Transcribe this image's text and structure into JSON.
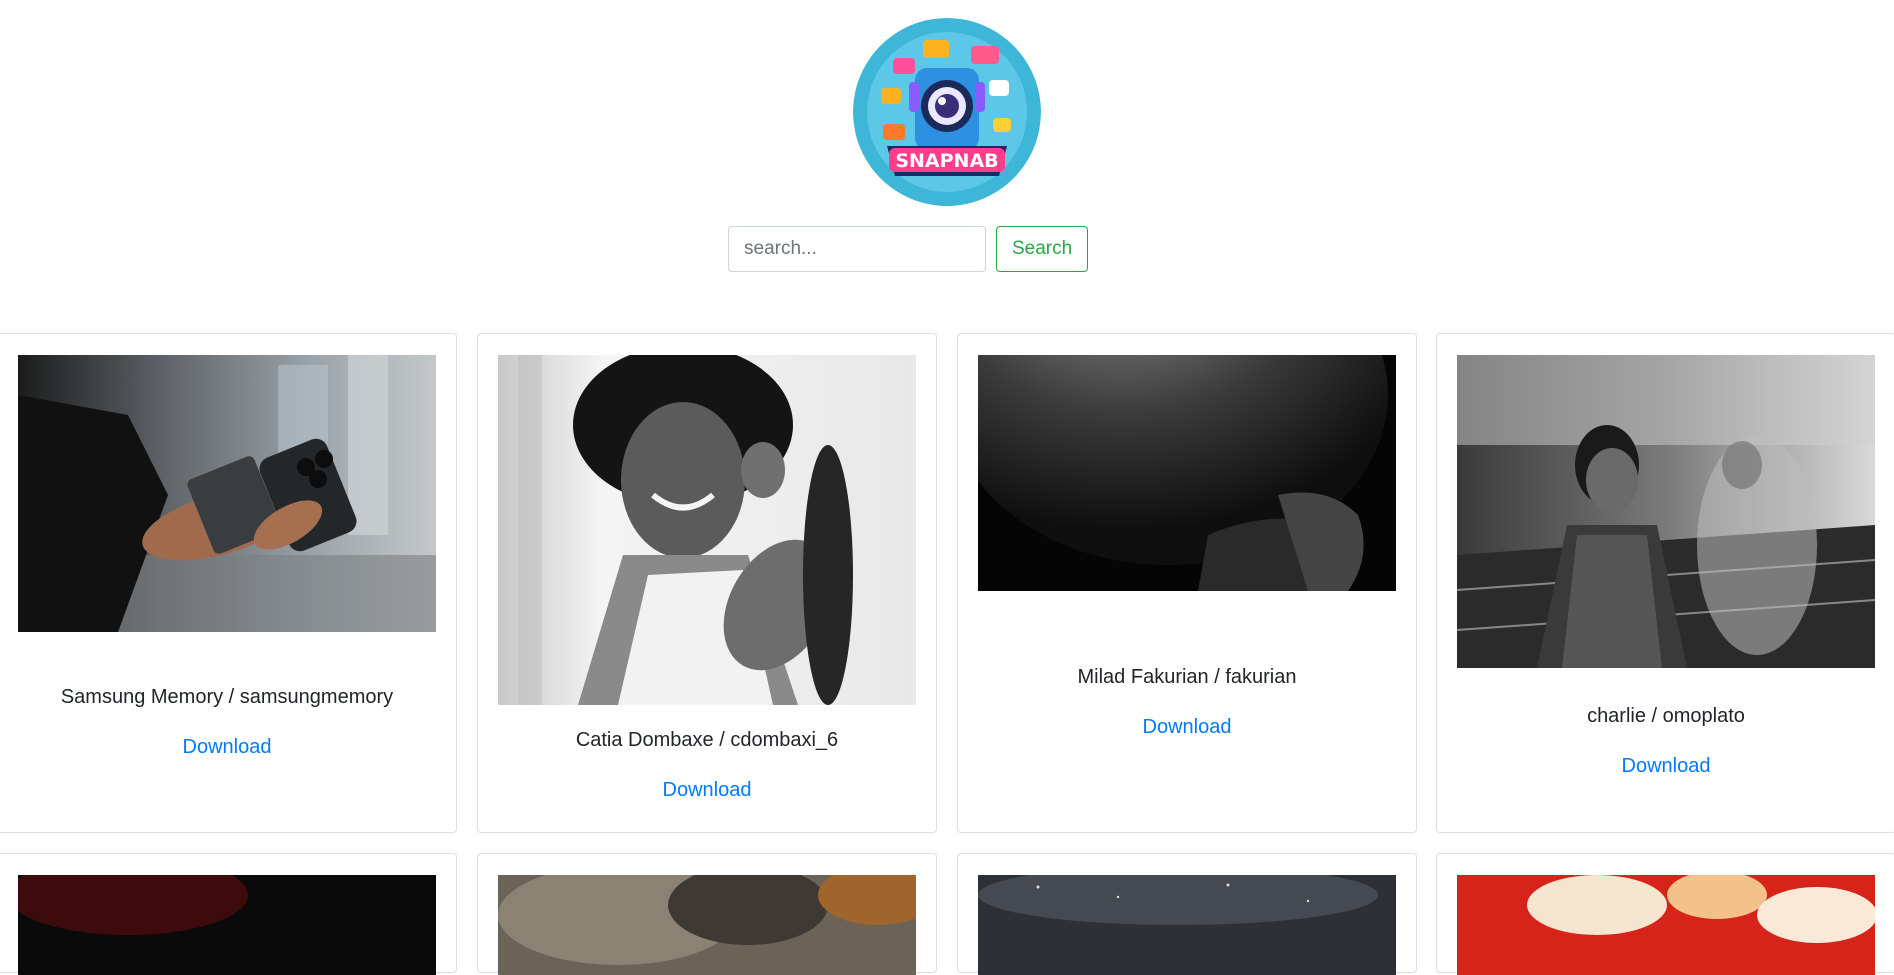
{
  "logo": {
    "text": "SNAPNAB"
  },
  "search": {
    "placeholder": "search...",
    "button_label": "Search"
  },
  "photos": [
    {
      "author": "Samsung Memory / samsungmemory",
      "link_label": "Download"
    },
    {
      "author": "Catia Dombaxe / cdombaxi_6",
      "link_label": "Download"
    },
    {
      "author": "Milad Fakurian / fakurian",
      "link_label": "Download"
    },
    {
      "author": "charlie / omoplato",
      "link_label": "Download"
    }
  ],
  "colors": {
    "accent_green": "#28a745",
    "link_blue": "#007bff",
    "card_border": "#dee2e6"
  }
}
